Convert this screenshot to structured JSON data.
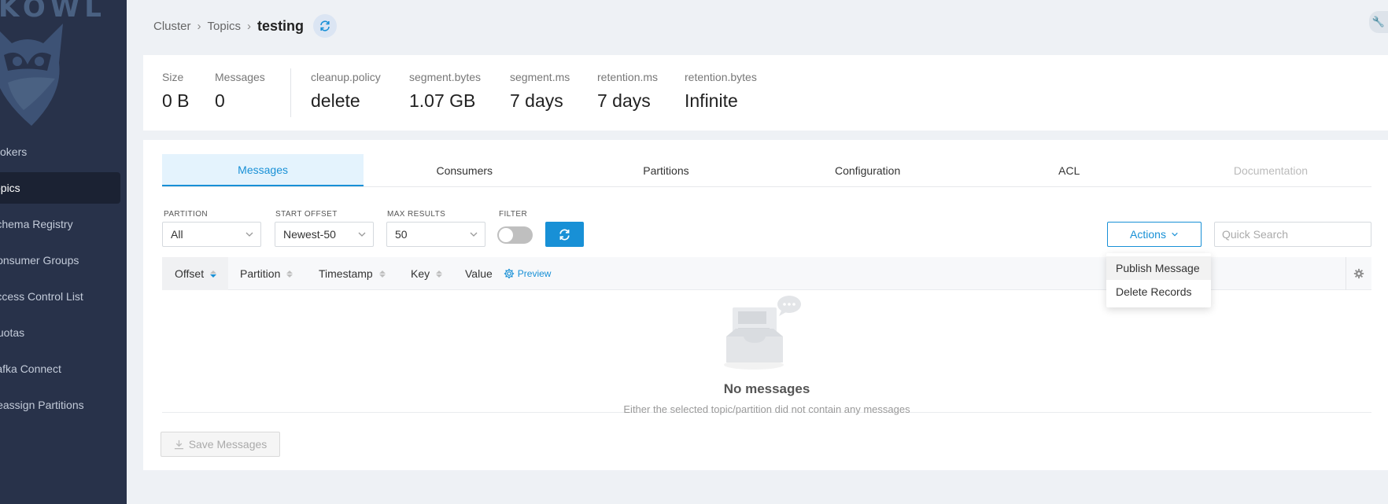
{
  "app": {
    "logo_text": "KOWL"
  },
  "sidebar": {
    "items": [
      {
        "label": "Brokers"
      },
      {
        "label": "Topics",
        "active": true
      },
      {
        "label": "Schema Registry"
      },
      {
        "label": "Consumer Groups"
      },
      {
        "label": "Access Control List"
      },
      {
        "label": "Quotas"
      },
      {
        "label": "Kafka Connect"
      },
      {
        "label": "Reassign Partitions"
      }
    ]
  },
  "breadcrumb": {
    "items": [
      "Cluster",
      "Topics"
    ],
    "current": "testing"
  },
  "stats": [
    {
      "label": "Size",
      "value": "0 B"
    },
    {
      "label": "Messages",
      "value": "0"
    },
    {
      "label": "cleanup.policy",
      "value": "delete"
    },
    {
      "label": "segment.bytes",
      "value": "1.07 GB"
    },
    {
      "label": "segment.ms",
      "value": "7 days"
    },
    {
      "label": "retention.ms",
      "value": "7 days"
    },
    {
      "label": "retention.bytes",
      "value": "Infinite"
    }
  ],
  "tabs": [
    {
      "label": "Messages",
      "active": true
    },
    {
      "label": "Consumers"
    },
    {
      "label": "Partitions"
    },
    {
      "label": "Configuration"
    },
    {
      "label": "ACL"
    },
    {
      "label": "Documentation",
      "disabled": true
    }
  ],
  "controls": {
    "partition": {
      "label": "PARTITION",
      "value": "All"
    },
    "start_offset": {
      "label": "START OFFSET",
      "value": "Newest-50"
    },
    "max_results": {
      "label": "MAX RESULTS",
      "value": "50"
    },
    "filter": {
      "label": "FILTER",
      "enabled": false
    },
    "actions_label": "Actions",
    "search_placeholder": "Quick Search"
  },
  "table": {
    "columns": [
      "Offset",
      "Partition",
      "Timestamp",
      "Key",
      "Value"
    ],
    "preview_label": "Preview"
  },
  "empty": {
    "title": "No messages",
    "description": "Either the selected topic/partition did not contain any messages"
  },
  "save_label": "Save Messages",
  "actions_menu": [
    "Publish Message",
    "Delete Records"
  ],
  "colors": {
    "accent": "#1890d6",
    "sidebar": "#28324a"
  }
}
